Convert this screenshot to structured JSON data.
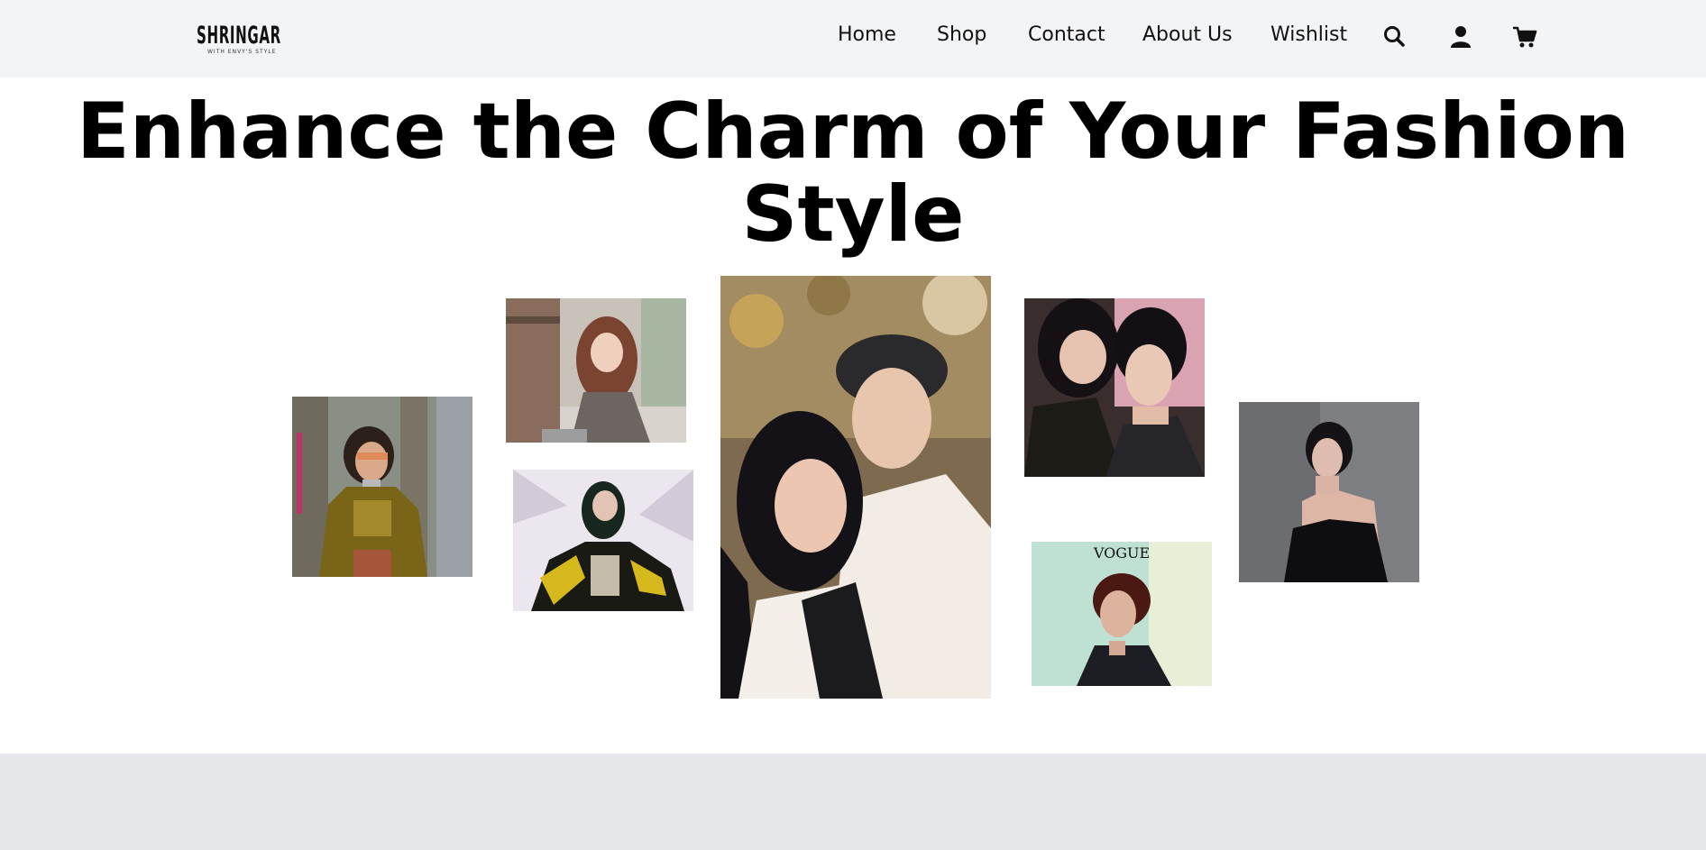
{
  "header": {
    "logo": {
      "text": "SHRINGAR",
      "tagline": "WITH ENVY'S STYLE"
    },
    "nav": [
      {
        "label": "Home"
      },
      {
        "label": "Shop"
      },
      {
        "label": "Contact"
      },
      {
        "label": "About Us"
      },
      {
        "label": "Wishlist"
      }
    ],
    "icons": [
      "search-icon",
      "user-icon",
      "cart-icon"
    ]
  },
  "hero": {
    "title_line1": "Enhance the Charm of Your Fashion",
    "title_line2": "Style"
  },
  "gallery": {
    "photos": [
      {
        "name": "street-style-photo"
      },
      {
        "name": "girl-in-alley-photo"
      },
      {
        "name": "yellow-jacket-photo"
      },
      {
        "name": "couple-beret-photo"
      },
      {
        "name": "couple-selfie-photo"
      },
      {
        "name": "vogue-cover-photo",
        "caption": "VOGUE"
      },
      {
        "name": "black-dress-photo"
      }
    ]
  },
  "colors": {
    "header_bg": "#f3f4f6",
    "footer_bg": "#e5e7eb",
    "text": "#111111"
  }
}
